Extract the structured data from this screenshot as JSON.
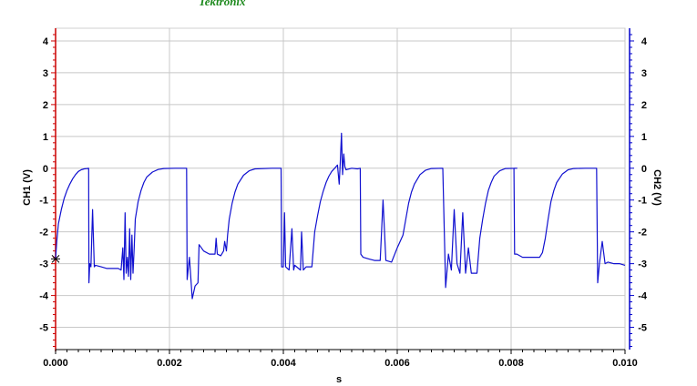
{
  "header": {
    "brand": "Tektronix",
    "brand_color": "#1f8a1f"
  },
  "chart_data": {
    "type": "line",
    "title": "",
    "xlabel": "s",
    "ylabel_left": "CH1 (V)",
    "ylabel_right": "CH2 (V)",
    "xlim": [
      0.0,
      0.01
    ],
    "ylim": [
      -5.7,
      4.4
    ],
    "grid": true,
    "x_ticks": [
      {
        "value": 0.0,
        "label": "0.000"
      },
      {
        "value": 0.002,
        "label": "0.002"
      },
      {
        "value": 0.004,
        "label": "0.004"
      },
      {
        "value": 0.006,
        "label": "0.006"
      },
      {
        "value": 0.008,
        "label": "0.008"
      },
      {
        "value": 0.01,
        "label": "0.010"
      }
    ],
    "y_ticks": [
      {
        "value": 4,
        "label": "4"
      },
      {
        "value": 3,
        "label": "3"
      },
      {
        "value": 2,
        "label": "2"
      },
      {
        "value": 1,
        "label": "1"
      },
      {
        "value": 0,
        "label": "0"
      },
      {
        "value": -1,
        "label": "-1"
      },
      {
        "value": -2,
        "label": "-2"
      },
      {
        "value": -3,
        "label": "-3"
      },
      {
        "value": -4,
        "label": "-4"
      },
      {
        "value": -5,
        "label": "-5"
      }
    ],
    "colors": {
      "left_axis": "#cc0000",
      "right_axis": "#0000cc",
      "trace": "#1010d0",
      "grid": "#c8c8c8"
    },
    "series": [
      {
        "name": "",
        "color": "#1010d0",
        "points": [
          [
            0.0,
            -2.85
          ],
          [
            2e-05,
            -2.3
          ],
          [
            5e-05,
            -1.75
          ],
          [
            0.0001,
            -1.3
          ],
          [
            0.00015,
            -0.95
          ],
          [
            0.0002,
            -0.7
          ],
          [
            0.00025,
            -0.5
          ],
          [
            0.0003,
            -0.33
          ],
          [
            0.00035,
            -0.2
          ],
          [
            0.0004,
            -0.1
          ],
          [
            0.00045,
            -0.05
          ],
          [
            0.0005,
            -0.02
          ],
          [
            0.00055,
            -0.01
          ],
          [
            0.00058,
            0.0
          ],
          [
            0.000585,
            -3.6
          ],
          [
            0.0006,
            -3.0
          ],
          [
            0.00062,
            -3.1
          ],
          [
            0.00065,
            -1.3
          ],
          [
            0.00068,
            -3.1
          ],
          [
            0.0007,
            -3.05
          ],
          [
            0.0008,
            -3.1
          ],
          [
            0.0009,
            -3.15
          ],
          [
            0.001,
            -3.15
          ],
          [
            0.0011,
            -3.15
          ],
          [
            0.00115,
            -3.2
          ],
          [
            0.00118,
            -2.5
          ],
          [
            0.0012,
            -3.5
          ],
          [
            0.00122,
            -1.4
          ],
          [
            0.00124,
            -3.3
          ],
          [
            0.00126,
            -2.8
          ],
          [
            0.00128,
            -3.4
          ],
          [
            0.0013,
            -1.9
          ],
          [
            0.00132,
            -3.5
          ],
          [
            0.00134,
            -2.1
          ],
          [
            0.00136,
            -3.3
          ],
          [
            0.00138,
            -2.5
          ],
          [
            0.0014,
            -1.6
          ],
          [
            0.00145,
            -1.05
          ],
          [
            0.0015,
            -0.7
          ],
          [
            0.00155,
            -0.45
          ],
          [
            0.0016,
            -0.28
          ],
          [
            0.0017,
            -0.12
          ],
          [
            0.0018,
            -0.04
          ],
          [
            0.0019,
            -0.01
          ],
          [
            0.0021,
            0.0
          ],
          [
            0.0023,
            0.0
          ],
          [
            0.00231,
            -3.5
          ],
          [
            0.00235,
            -2.8
          ],
          [
            0.0024,
            -4.1
          ],
          [
            0.00245,
            -3.7
          ],
          [
            0.0025,
            -3.6
          ],
          [
            0.00252,
            -2.4
          ],
          [
            0.0026,
            -2.6
          ],
          [
            0.0027,
            -2.7
          ],
          [
            0.0028,
            -2.7
          ],
          [
            0.00282,
            -2.2
          ],
          [
            0.00284,
            -2.7
          ],
          [
            0.0029,
            -2.75
          ],
          [
            0.00295,
            -2.6
          ],
          [
            0.00297,
            -2.3
          ],
          [
            0.003,
            -2.6
          ],
          [
            0.00302,
            -2.1
          ],
          [
            0.00305,
            -1.6
          ],
          [
            0.0031,
            -1.1
          ],
          [
            0.00315,
            -0.75
          ],
          [
            0.0032,
            -0.5
          ],
          [
            0.0033,
            -0.22
          ],
          [
            0.0034,
            -0.08
          ],
          [
            0.0035,
            -0.02
          ],
          [
            0.0038,
            0.0
          ],
          [
            0.00396,
            0.0
          ],
          [
            0.00397,
            -3.1
          ],
          [
            0.004,
            -3.1
          ],
          [
            0.00402,
            -1.4
          ],
          [
            0.00404,
            -3.1
          ],
          [
            0.0041,
            -3.2
          ],
          [
            0.00415,
            -1.9
          ],
          [
            0.00418,
            -3.2
          ],
          [
            0.0042,
            -3.05
          ],
          [
            0.0043,
            -3.2
          ],
          [
            0.00432,
            -2.0
          ],
          [
            0.00435,
            -3.2
          ],
          [
            0.0044,
            -3.1
          ],
          [
            0.0045,
            -3.1
          ],
          [
            0.00455,
            -2.0
          ],
          [
            0.0046,
            -1.5
          ],
          [
            0.00465,
            -1.05
          ],
          [
            0.0047,
            -0.72
          ],
          [
            0.00475,
            -0.45
          ],
          [
            0.0048,
            -0.25
          ],
          [
            0.00485,
            -0.1
          ],
          [
            0.0049,
            0.0
          ],
          [
            0.00495,
            0.1
          ],
          [
            0.00498,
            -0.5
          ],
          [
            0.005,
            0.2
          ],
          [
            0.00502,
            1.1
          ],
          [
            0.00504,
            -0.2
          ],
          [
            0.00506,
            0.45
          ],
          [
            0.00508,
            0.05
          ],
          [
            0.0051,
            -0.05
          ],
          [
            0.0052,
            0.0
          ],
          [
            0.0053,
            -0.02
          ],
          [
            0.00535,
            0.0
          ],
          [
            0.00536,
            -2.7
          ],
          [
            0.0054,
            -2.8
          ],
          [
            0.0055,
            -2.85
          ],
          [
            0.0056,
            -2.9
          ],
          [
            0.0057,
            -2.9
          ],
          [
            0.00575,
            -1.0
          ],
          [
            0.0058,
            -2.9
          ],
          [
            0.0059,
            -2.95
          ],
          [
            0.006,
            -2.5
          ],
          [
            0.0061,
            -2.1
          ],
          [
            0.00615,
            -1.6
          ],
          [
            0.0062,
            -1.1
          ],
          [
            0.00625,
            -0.75
          ],
          [
            0.0063,
            -0.5
          ],
          [
            0.0064,
            -0.2
          ],
          [
            0.0065,
            -0.06
          ],
          [
            0.0066,
            -0.01
          ],
          [
            0.0068,
            0.0
          ],
          [
            0.00685,
            -3.75
          ],
          [
            0.0069,
            -2.7
          ],
          [
            0.00695,
            -3.2
          ],
          [
            0.007,
            -1.3
          ],
          [
            0.00705,
            -3.0
          ],
          [
            0.0071,
            -3.3
          ],
          [
            0.00715,
            -1.4
          ],
          [
            0.0072,
            -3.3
          ],
          [
            0.00725,
            -2.5
          ],
          [
            0.0073,
            -3.3
          ],
          [
            0.0074,
            -3.3
          ],
          [
            0.00745,
            -2.2
          ],
          [
            0.0075,
            -1.6
          ],
          [
            0.00755,
            -1.1
          ],
          [
            0.0076,
            -0.7
          ],
          [
            0.00765,
            -0.45
          ],
          [
            0.0077,
            -0.25
          ],
          [
            0.0078,
            -0.08
          ],
          [
            0.0079,
            -0.01
          ],
          [
            0.0081,
            0.0
          ],
          [
            0.00805,
            0.0
          ],
          [
            0.00806,
            -2.7
          ],
          [
            0.0081,
            -2.7
          ],
          [
            0.0082,
            -2.8
          ],
          [
            0.0083,
            -2.8
          ],
          [
            0.0084,
            -2.8
          ],
          [
            0.0085,
            -2.8
          ],
          [
            0.00855,
            -2.65
          ],
          [
            0.0086,
            -2.2
          ],
          [
            0.00865,
            -1.6
          ],
          [
            0.0087,
            -1.05
          ],
          [
            0.00875,
            -0.7
          ],
          [
            0.0088,
            -0.45
          ],
          [
            0.0089,
            -0.18
          ],
          [
            0.009,
            -0.05
          ],
          [
            0.0091,
            -0.01
          ],
          [
            0.0093,
            0.0
          ],
          [
            0.0095,
            0.0
          ],
          [
            0.00952,
            -3.6
          ],
          [
            0.00955,
            -3.0
          ],
          [
            0.0096,
            -2.3
          ],
          [
            0.00965,
            -3.0
          ],
          [
            0.0097,
            -2.95
          ],
          [
            0.0098,
            -3.0
          ],
          [
            0.0099,
            -3.0
          ],
          [
            0.01,
            -3.05
          ]
        ]
      }
    ]
  }
}
